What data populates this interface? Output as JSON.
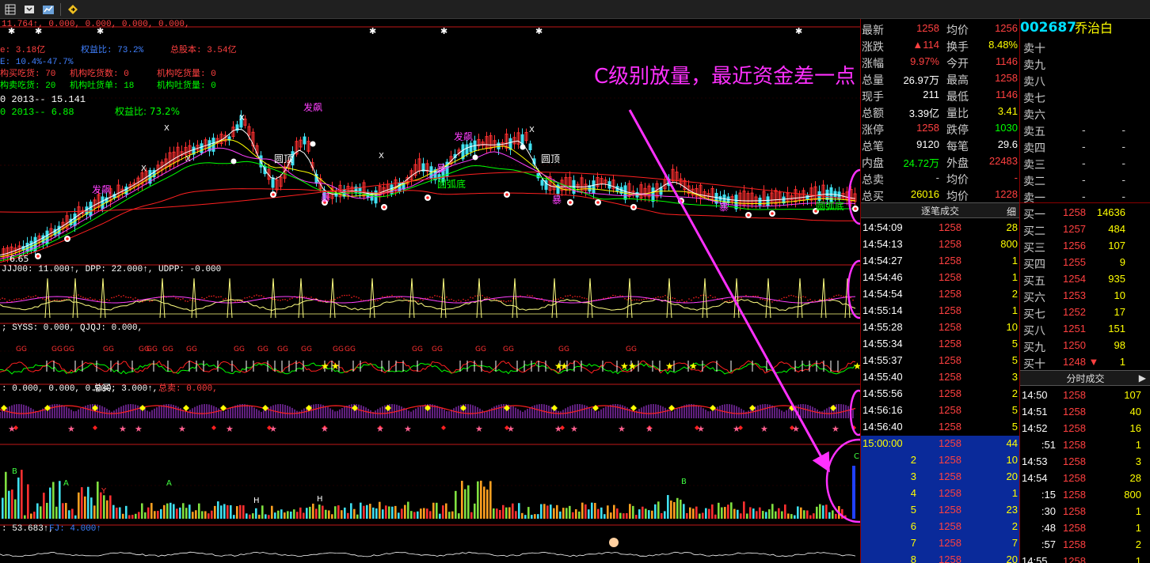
{
  "toolbar": {
    "icons": [
      "grid-icon",
      "download-icon",
      "chart-icon",
      "diamond-icon"
    ]
  },
  "main": {
    "ind_top": "11.764↑, 0.000, 0.000, 0.000, 0.000,",
    "info": {
      "l1a": "e: 3.18亿",
      "l1b": "权益比: 73.2%",
      "l1c": "总股本: 3.54亿",
      "l2": "E: 10.4%-47.7%",
      "l3a": "构买吃货: 70",
      "l3b": "机构吃货数: 0",
      "l3c": "机构吃货量: 0",
      "l4a": "构卖吃货: 20",
      "l4b": "机构吐货单: 18",
      "l4c": "机构吐货量: 0",
      "l5": "0    2013--  15.141",
      "l6a": "0    2013--  6.88",
      "l6b": "权益比: 73.2%"
    },
    "annotation": "C级别放量，最近资金差一点",
    "labels": {
      "fapiao": "发飙",
      "yuanding": "圆顶",
      "yuanwudi": "圆弧底",
      "bao": "暴"
    },
    "low_price": "6.65",
    "sub1": "JJJ00: 11.000↑, DPP: 22.000↑, UDPP: -0.000",
    "sub2": "; SYSS: 0.000, QJQJ: 0.000,",
    "sub3a": ": 0.000, 0.000, 0.000,",
    "sub3b": "总买: 3.000↑,",
    "sub3c": "总卖: 0.000,",
    "sub4a": ": 53.683↑,",
    "sub4b": "FJ: 4.000↑"
  },
  "quote": {
    "rows": [
      {
        "k1": "最新",
        "v1": "1258",
        "k2": "均价",
        "v2": "1256"
      },
      {
        "k1": "涨跌",
        "v1": "▲114",
        "k2": "换手",
        "v2": "8.48%"
      },
      {
        "k1": "涨幅",
        "v1": "9.97%",
        "k2": "今开",
        "v2": "1146"
      },
      {
        "k1": "总量",
        "v1": "26.97万",
        "k2": "最高",
        "v2": "1258"
      },
      {
        "k1": "现手",
        "v1": "211",
        "k2": "最低",
        "v2": "1146"
      },
      {
        "k1": "总额",
        "v1": "3.39亿",
        "k2": "量比",
        "v2": "3.41"
      },
      {
        "k1": "涨停",
        "v1": "1258",
        "k2": "跌停",
        "v2": "1030"
      },
      {
        "k1": "总笔",
        "v1": "9120",
        "k2": "每笔",
        "v2": "29.6"
      },
      {
        "k1": "内盘",
        "v1": "24.72万",
        "k2": "外盘",
        "v2": "22483"
      },
      {
        "k1": "总卖",
        "v1": "-",
        "k2": "均价",
        "v2": "-"
      },
      {
        "k1": "总买",
        "v1": "26016",
        "k2": "均价",
        "v2": "1228"
      }
    ],
    "tick_title": "逐笔成交",
    "tick_btn": "细",
    "ticks": [
      [
        "14:54:09",
        "1258",
        "28"
      ],
      [
        "14:54:13",
        "1258",
        "800"
      ],
      [
        "14:54:27",
        "1258",
        "1"
      ],
      [
        "14:54:46",
        "1258",
        "1"
      ],
      [
        "14:54:54",
        "1258",
        "2"
      ],
      [
        "14:55:14",
        "1258",
        "1"
      ],
      [
        "14:55:28",
        "1258",
        "10"
      ],
      [
        "14:55:34",
        "1258",
        "5"
      ],
      [
        "14:55:37",
        "1258",
        "5"
      ],
      [
        "14:55:40",
        "1258",
        "3"
      ],
      [
        "14:55:56",
        "1258",
        "2"
      ],
      [
        "14:56:16",
        "1258",
        "5"
      ],
      [
        "14:56:40",
        "1258",
        "5"
      ],
      [
        "15:00:00",
        "1258",
        "44"
      ],
      [
        "2",
        "1258",
        "10"
      ],
      [
        "3",
        "1258",
        "20"
      ],
      [
        "4",
        "1258",
        "1"
      ],
      [
        "5",
        "1258",
        "23"
      ],
      [
        "6",
        "1258",
        "2"
      ],
      [
        "7",
        "1258",
        "7"
      ],
      [
        "8",
        "1258",
        "20"
      ]
    ]
  },
  "stock": {
    "code": "002687",
    "name": "乔治白"
  },
  "orderbook": {
    "asks": [
      [
        "卖十",
        "",
        ""
      ],
      [
        "卖九",
        "",
        ""
      ],
      [
        "卖八",
        "",
        ""
      ],
      [
        "卖七",
        "",
        ""
      ],
      [
        "卖六",
        "",
        ""
      ],
      [
        "卖五",
        "-",
        "-"
      ],
      [
        "卖四",
        "-",
        "-"
      ],
      [
        "卖三",
        "-",
        "-"
      ],
      [
        "卖二",
        "-",
        "-"
      ],
      [
        "卖一",
        "-",
        "-"
      ]
    ],
    "bids": [
      [
        "买一",
        "1258",
        "14636"
      ],
      [
        "买二",
        "1257",
        "484"
      ],
      [
        "买三",
        "1256",
        "107"
      ],
      [
        "买四",
        "1255",
        "9"
      ],
      [
        "买五",
        "1254",
        "935"
      ],
      [
        "买六",
        "1253",
        "10"
      ],
      [
        "买七",
        "1252",
        "17"
      ],
      [
        "买八",
        "1251",
        "151"
      ],
      [
        "买九",
        "1250",
        "98"
      ],
      [
        "买十",
        "1248 ▼",
        "1"
      ]
    ],
    "fenshi_title": "分时成交",
    "fenshi_arrow": "▶",
    "fenshi": [
      [
        "14:50",
        "1258",
        "107"
      ],
      [
        "14:51",
        "1258",
        "40"
      ],
      [
        "14:52",
        "1258",
        "16"
      ],
      [
        ":51",
        "1258",
        "1"
      ],
      [
        "14:53",
        "1258",
        "3"
      ],
      [
        "14:54",
        "1258",
        "28"
      ],
      [
        ":15",
        "1258",
        "800"
      ],
      [
        ":30",
        "1258",
        "1"
      ],
      [
        ":48",
        "1258",
        "1"
      ],
      [
        ":57",
        "1258",
        "2"
      ],
      [
        "14:55",
        "1258",
        "1"
      ]
    ]
  }
}
